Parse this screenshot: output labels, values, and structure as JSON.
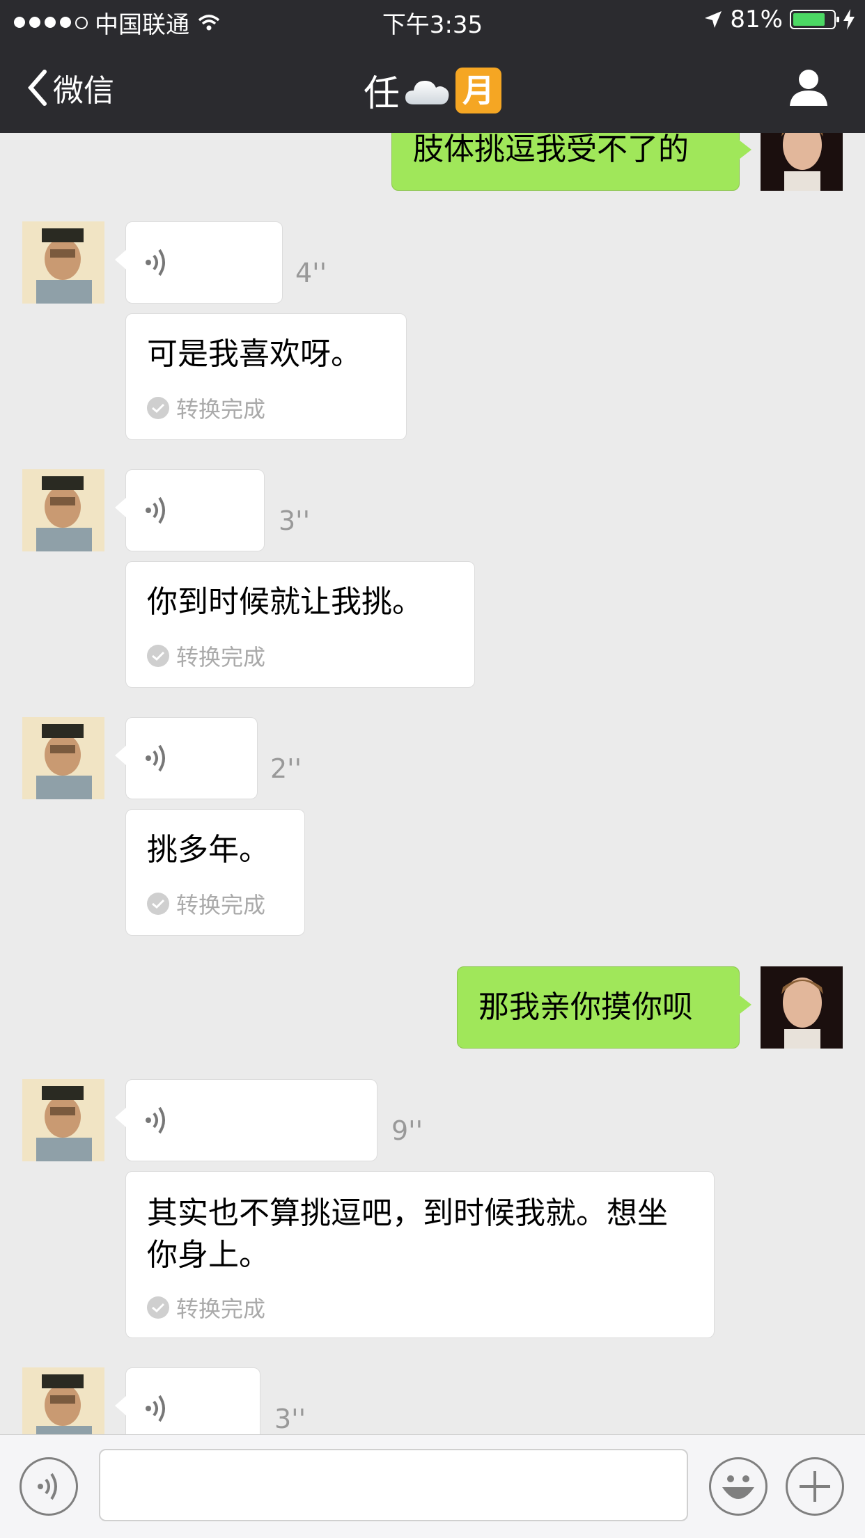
{
  "status_bar": {
    "carrier": "中国联通",
    "time": "下午3:35",
    "battery_percent": "81%",
    "battery_level": 0.81
  },
  "nav": {
    "back_label": "微信",
    "title": "任",
    "title_badge": "月"
  },
  "messages": [
    {
      "from": "me",
      "type": "text",
      "text": "肢体挑逗我受不了的"
    },
    {
      "from": "friend",
      "type": "voice",
      "duration": "4''",
      "transcript": "可是我喜欢呀。",
      "conv_status": "转换完成"
    },
    {
      "from": "friend",
      "type": "voice",
      "duration": "3''",
      "transcript": "你到时候就让我挑。",
      "conv_status": "转换完成"
    },
    {
      "from": "friend",
      "type": "voice",
      "duration": "2''",
      "transcript": "挑多年。",
      "conv_status": "转换完成"
    },
    {
      "from": "me",
      "type": "text",
      "text": "那我亲你摸你呗"
    },
    {
      "from": "friend",
      "type": "voice",
      "duration": "9''",
      "transcript": "其实也不算挑逗吧，到时候我就。想坐你身上。",
      "conv_status": "转换完成"
    },
    {
      "from": "friend",
      "type": "voice",
      "duration": "3''"
    }
  ],
  "colors": {
    "nav_bg": "#2b2b2f",
    "chat_bg": "#ebebeb",
    "my_bubble": "#a0e75a",
    "friend_bubble": "#ffffff",
    "battery_fill": "#4cd964"
  },
  "icons": {
    "back": "chevron-left-icon",
    "contact": "person-icon",
    "voice_toggle": "voice-icon",
    "emoji": "emoji-icon",
    "more": "plus-icon"
  }
}
